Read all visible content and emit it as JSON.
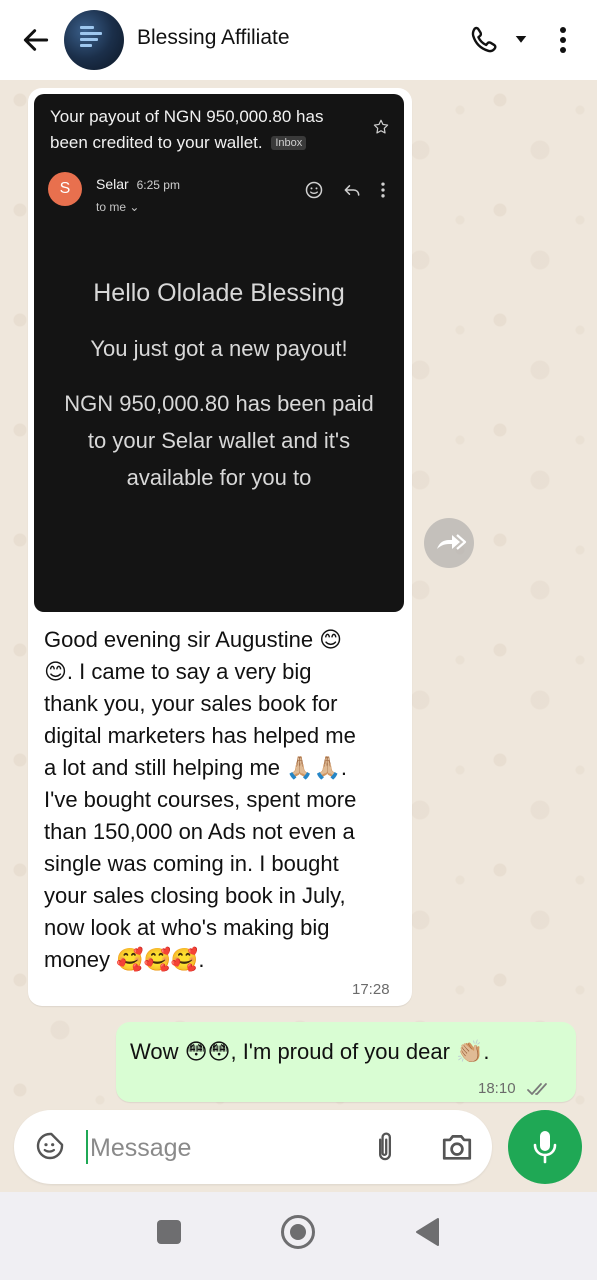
{
  "header": {
    "title": "Blessing Affiliate"
  },
  "incoming_message": {
    "email_screenshot": {
      "subject_line_1": "Your payout of NGN 950,000.80 has",
      "subject_line_2": "been credited to your wallet.",
      "badge": "Inbox",
      "sender_initial": "S",
      "sender_name": "Selar",
      "sender_time": "6:25 pm",
      "recipient": "to me",
      "body_greeting": "Hello Ololade Blessing",
      "body_line_1": "You just got a new payout!",
      "body_line_2": "NGN 950,000.80 has been paid to your Selar wallet and it's available for you to"
    },
    "text": "Good evening sir Augustine 😊\n😊. I came to say a very big\nthank you, your sales book for\ndigital marketers has helped me\na lot and still helping me 🙏🏼🙏🏼.\nI've bought courses, spent more\nthan 150,000 on Ads not even a\nsingle was coming in. I bought\nyour sales closing book in July,\nnow look at who's making big\nmoney 🥰🥰🥰.",
    "time": "17:28"
  },
  "outgoing_message": {
    "text": "Wow 😳😳, I'm proud of you dear 👏🏼.",
    "time": "18:10"
  },
  "composer": {
    "placeholder": "Message"
  },
  "icons": {
    "back": "arrow-left",
    "call": "phone",
    "menu": "more-vertical",
    "forward": "forward-arrows",
    "sticker": "sticker",
    "attach": "paperclip",
    "camera": "camera",
    "mic": "microphone"
  },
  "colors": {
    "accent": "#1fa855",
    "outgoing_bubble": "#d9fdd3",
    "incoming_bubble": "#ffffff",
    "wallpaper": "#efe7dc"
  }
}
